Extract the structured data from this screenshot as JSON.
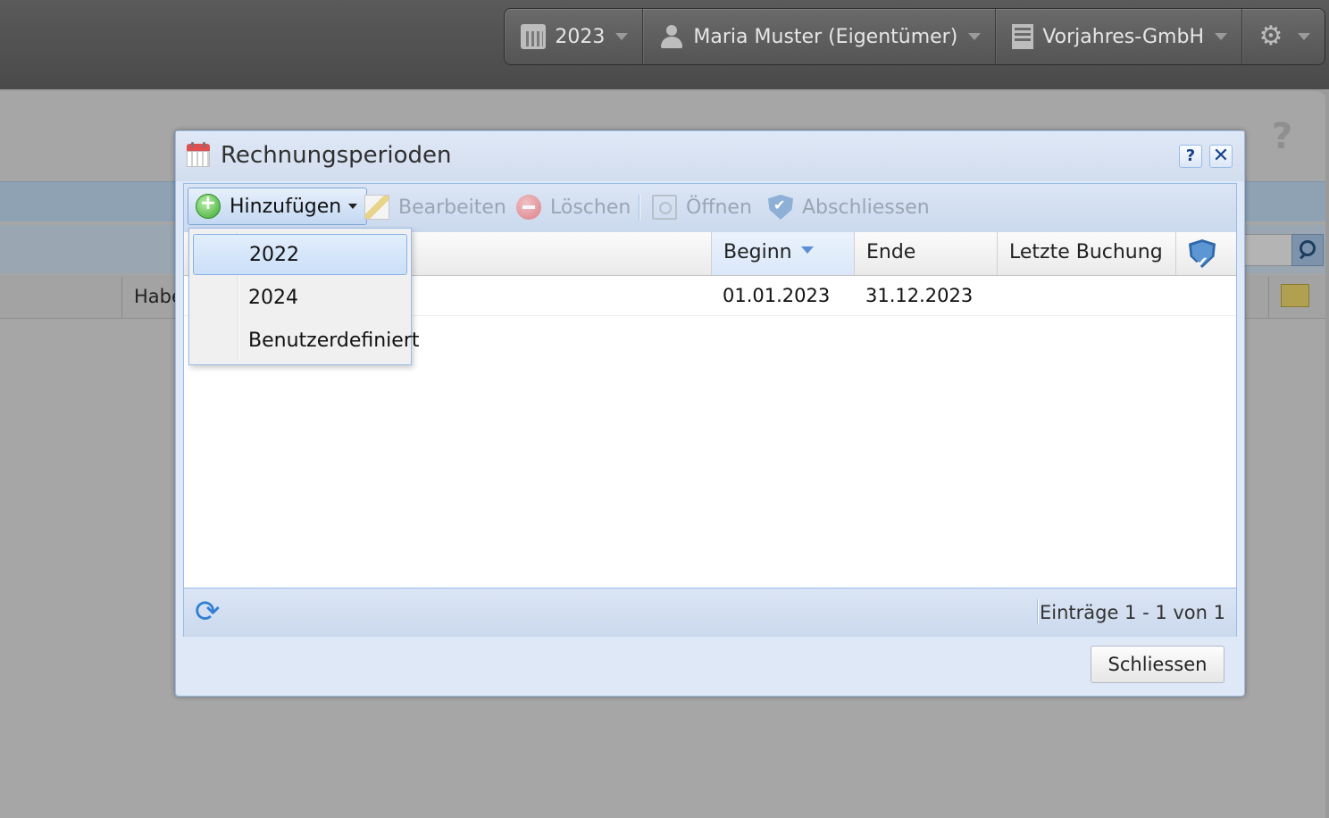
{
  "topbar": {
    "year": "2023",
    "user": "Maria Muster (Eigentümer)",
    "company": "Vorjahres-GmbH"
  },
  "background": {
    "help": "?",
    "column_partial": "Habe"
  },
  "window": {
    "title": "Rechnungsperioden",
    "help_tool": "?",
    "close_tool": "✕",
    "toolbar": {
      "add": "Hinzufügen",
      "edit": "Bearbeiten",
      "delete": "Löschen",
      "open": "Öffnen",
      "close_period": "Abschliessen"
    },
    "grid": {
      "columns": [
        "Beginn",
        "Ende",
        "Letzte Buchung"
      ],
      "rows": [
        {
          "begin": "01.01.2023",
          "end": "31.12.2023",
          "last_booking": ""
        }
      ]
    },
    "paging": {
      "info": "Einträge 1 - 1 von 1"
    },
    "close_button": "Schliessen"
  },
  "add_menu": {
    "items": [
      "2022",
      "2024",
      "Benutzerdefiniert"
    ],
    "active_index": 0
  },
  "colors": {
    "window_bg": "#dfe8f6",
    "window_border": "#99bbe8",
    "topbar_bg": "#4a4a4a",
    "sort_arrow": "#5a8ed6"
  }
}
